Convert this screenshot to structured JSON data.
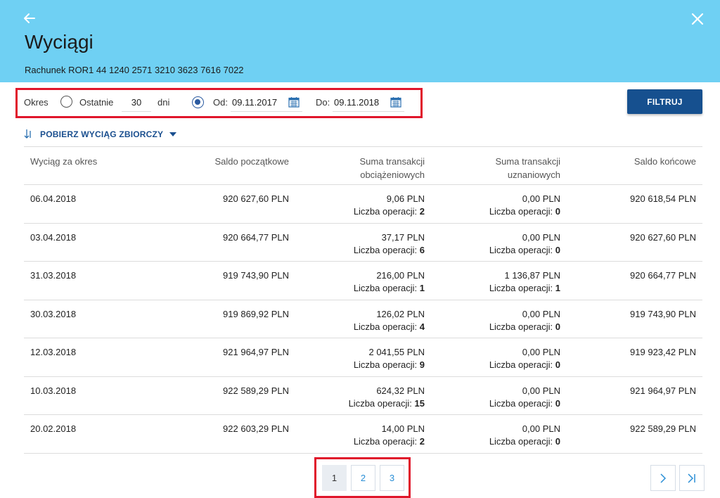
{
  "header": {
    "title": "Wyciągi",
    "account": "Rachunek ROR1 44 1240 2571 3210 3623 7616 7022"
  },
  "filter": {
    "period_label": "Okres",
    "last_label": "Ostatnie",
    "days_value": "30",
    "days_unit": "dni",
    "from_label": "Od:",
    "from_value": "09.11.2017",
    "to_label": "Do:",
    "to_value": "09.11.2018",
    "selected": "range",
    "button_label": "FILTRUJ"
  },
  "download": {
    "label": "POBIERZ WYCIĄG ZBIORCZY"
  },
  "table": {
    "headers": {
      "period": "Wyciąg za okres",
      "opening": "Saldo początkowe",
      "debit_l1": "Suma transakcji",
      "debit_l2": "obciążeniowych",
      "credit_l1": "Suma transakcji",
      "credit_l2": "uznaniowych",
      "closing": "Saldo końcowe"
    },
    "ops_label": "Liczba operacji:",
    "rows": [
      {
        "date": "06.04.2018",
        "opening": "920 627,60  PLN",
        "debit": "9,06  PLN",
        "debit_ops": "2",
        "credit": "0,00  PLN",
        "credit_ops": "0",
        "closing": "920 618,54  PLN"
      },
      {
        "date": "03.04.2018",
        "opening": "920 664,77  PLN",
        "debit": "37,17  PLN",
        "debit_ops": "6",
        "credit": "0,00  PLN",
        "credit_ops": "0",
        "closing": "920 627,60  PLN"
      },
      {
        "date": "31.03.2018",
        "opening": "919 743,90  PLN",
        "debit": "216,00  PLN",
        "debit_ops": "1",
        "credit": "1 136,87  PLN",
        "credit_ops": "1",
        "closing": "920 664,77  PLN"
      },
      {
        "date": "30.03.2018",
        "opening": "919 869,92  PLN",
        "debit": "126,02  PLN",
        "debit_ops": "4",
        "credit": "0,00  PLN",
        "credit_ops": "0",
        "closing": "919 743,90  PLN"
      },
      {
        "date": "12.03.2018",
        "opening": "921 964,97  PLN",
        "debit": "2 041,55  PLN",
        "debit_ops": "9",
        "credit": "0,00  PLN",
        "credit_ops": "0",
        "closing": "919 923,42  PLN"
      },
      {
        "date": "10.03.2018",
        "opening": "922 589,29  PLN",
        "debit": "624,32  PLN",
        "debit_ops": "15",
        "credit": "0,00  PLN",
        "credit_ops": "0",
        "closing": "921 964,97  PLN"
      },
      {
        "date": "20.02.2018",
        "opening": "922 603,29  PLN",
        "debit": "14,00  PLN",
        "debit_ops": "2",
        "credit": "0,00  PLN",
        "credit_ops": "0",
        "closing": "922 589,29  PLN"
      }
    ]
  },
  "pagination": {
    "pages": [
      "1",
      "2",
      "3"
    ],
    "active": "1"
  },
  "colors": {
    "header_bg": "#6fd0f3",
    "primary": "#16508f",
    "highlight": "#e0162b",
    "link": "#2a8fd6"
  },
  "icons": {
    "back": "arrow-left-icon",
    "close": "close-icon",
    "calendar": "calendar-icon",
    "download": "download-arrow-icon",
    "caret": "caret-down-icon",
    "next": "chevron-right-icon",
    "last": "last-page-icon"
  }
}
